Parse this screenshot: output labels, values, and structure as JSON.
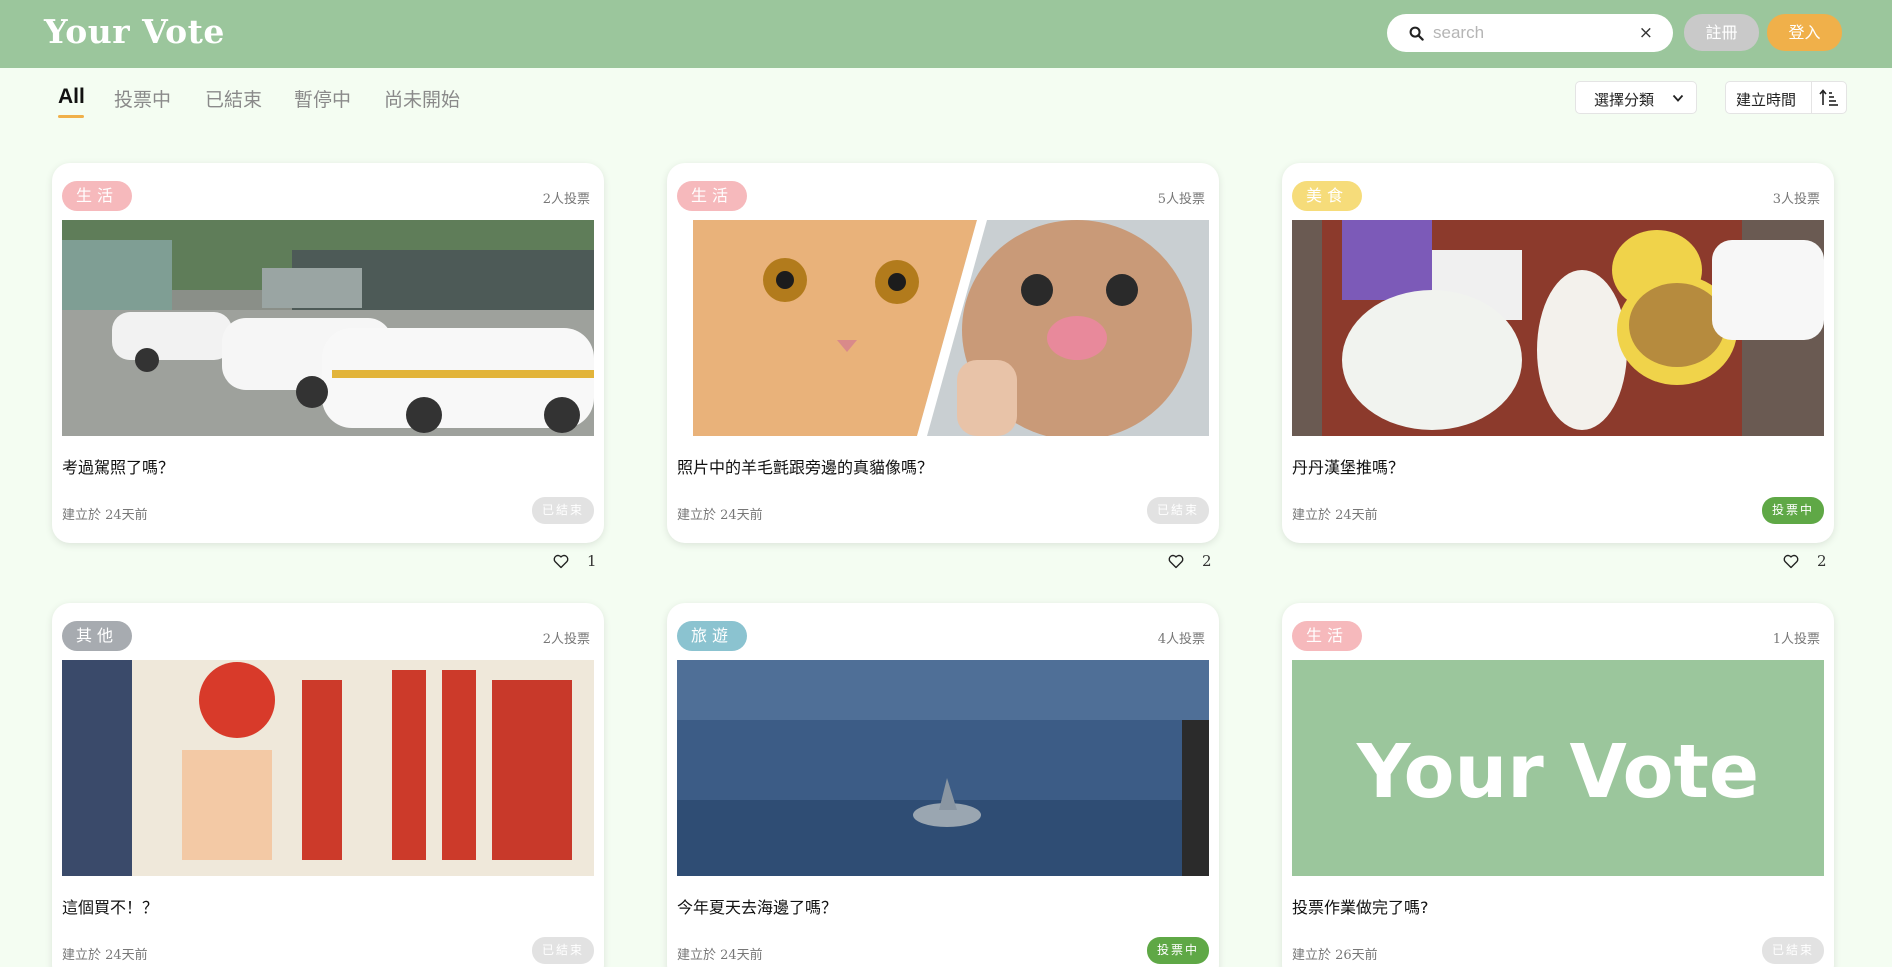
{
  "header": {
    "logo": "Your Vote",
    "search_placeholder": "search",
    "search_value": "",
    "clear_icon": "×",
    "register_label": "註冊",
    "login_label": "登入"
  },
  "tabs": [
    {
      "label": "All",
      "active": true
    },
    {
      "label": "投票中",
      "active": false
    },
    {
      "label": "已結束",
      "active": false
    },
    {
      "label": "暫停中",
      "active": false
    },
    {
      "label": "尚未開始",
      "active": false
    }
  ],
  "filters": {
    "category_label": "選擇分類",
    "sort_label": "建立時間"
  },
  "colors": {
    "header": "#9bc69c",
    "login": "#f0b04a",
    "register": "#c9c9c9",
    "background": "#f4fdf2",
    "live": "#5fa846",
    "ended": "#e2e2e2",
    "cat_life": "#f6b9bc",
    "cat_food": "#f6dc7a",
    "cat_other": "#a7abb0",
    "cat_travel": "#8bc3d0"
  },
  "cards": [
    {
      "category": "生活",
      "votes": "2人投票",
      "title": "考過駕照了嗎？",
      "created": "建立於 24天前",
      "status": "已結束",
      "likes": "1",
      "photo": "driving-school-cars"
    },
    {
      "category": "生活",
      "votes": "5人投票",
      "title": "照片中的羊毛氈跟旁邊的真貓像嗎？",
      "created": "建立於 24天前",
      "status": "已結束",
      "likes": "2",
      "photo": "cat-and-felt-cat"
    },
    {
      "category": "美食",
      "votes": "3人投票",
      "title": "丹丹漢堡推嗎？",
      "created": "建立於 24天前",
      "status": "投票中",
      "likes": "2",
      "photo": "fast-food-tray"
    },
    {
      "category": "其他",
      "votes": "2人投票",
      "title": "這個買不！？",
      "created": "建立於 24天前",
      "status": "已結束",
      "photo": "english-book-cover"
    },
    {
      "category": "旅遊",
      "votes": "4人投票",
      "title": "今年夏天去海邊了嗎？",
      "created": "建立於 24天前",
      "status": "投票中",
      "photo": "dolphin-sea"
    },
    {
      "category": "生活",
      "votes": "1人投票",
      "title": "投票作業做完了嗎?",
      "created": "建立於 26天前",
      "status": "已結束",
      "photo": "your-vote-banner",
      "banner_text": "Your Vote"
    }
  ]
}
